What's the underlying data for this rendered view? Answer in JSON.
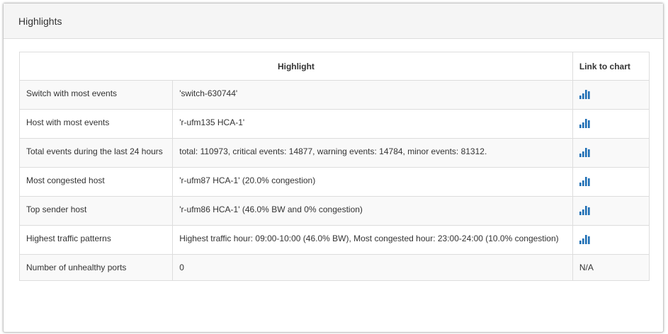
{
  "panel": {
    "title": "Highlights"
  },
  "table": {
    "headers": {
      "highlight": "Highlight",
      "link": "Link to chart"
    },
    "rows": [
      {
        "label": "Switch with most events",
        "value": "'switch-630744'",
        "link": "chart"
      },
      {
        "label": "Host with most events",
        "value": "'r-ufm135 HCA-1'",
        "link": "chart"
      },
      {
        "label": "Total events during the last 24 hours",
        "value": "total: 110973, critical events: 14877, warning events: 14784, minor events: 81312.",
        "link": "chart"
      },
      {
        "label": "Most congested host",
        "value": "'r-ufm87 HCA-1' (20.0% congestion)",
        "link": "chart"
      },
      {
        "label": "Top sender host",
        "value": "'r-ufm86 HCA-1' (46.0% BW and 0% congestion)",
        "link": "chart"
      },
      {
        "label": "Highest traffic patterns",
        "value": "Highest traffic hour: 09:00-10:00 (46.0% BW), Most congested hour: 23:00-24:00 (10.0% congestion)",
        "link": "chart"
      },
      {
        "label": "Number of unhealthy ports",
        "value": "0",
        "link": "N/A"
      }
    ]
  },
  "colors": {
    "icon": "#1f6fb5",
    "stripe": "#f9f9f9",
    "border": "#dddddd",
    "heading_bg": "#f5f5f5"
  },
  "icons": {
    "chart_link": "bar-chart-icon"
  }
}
